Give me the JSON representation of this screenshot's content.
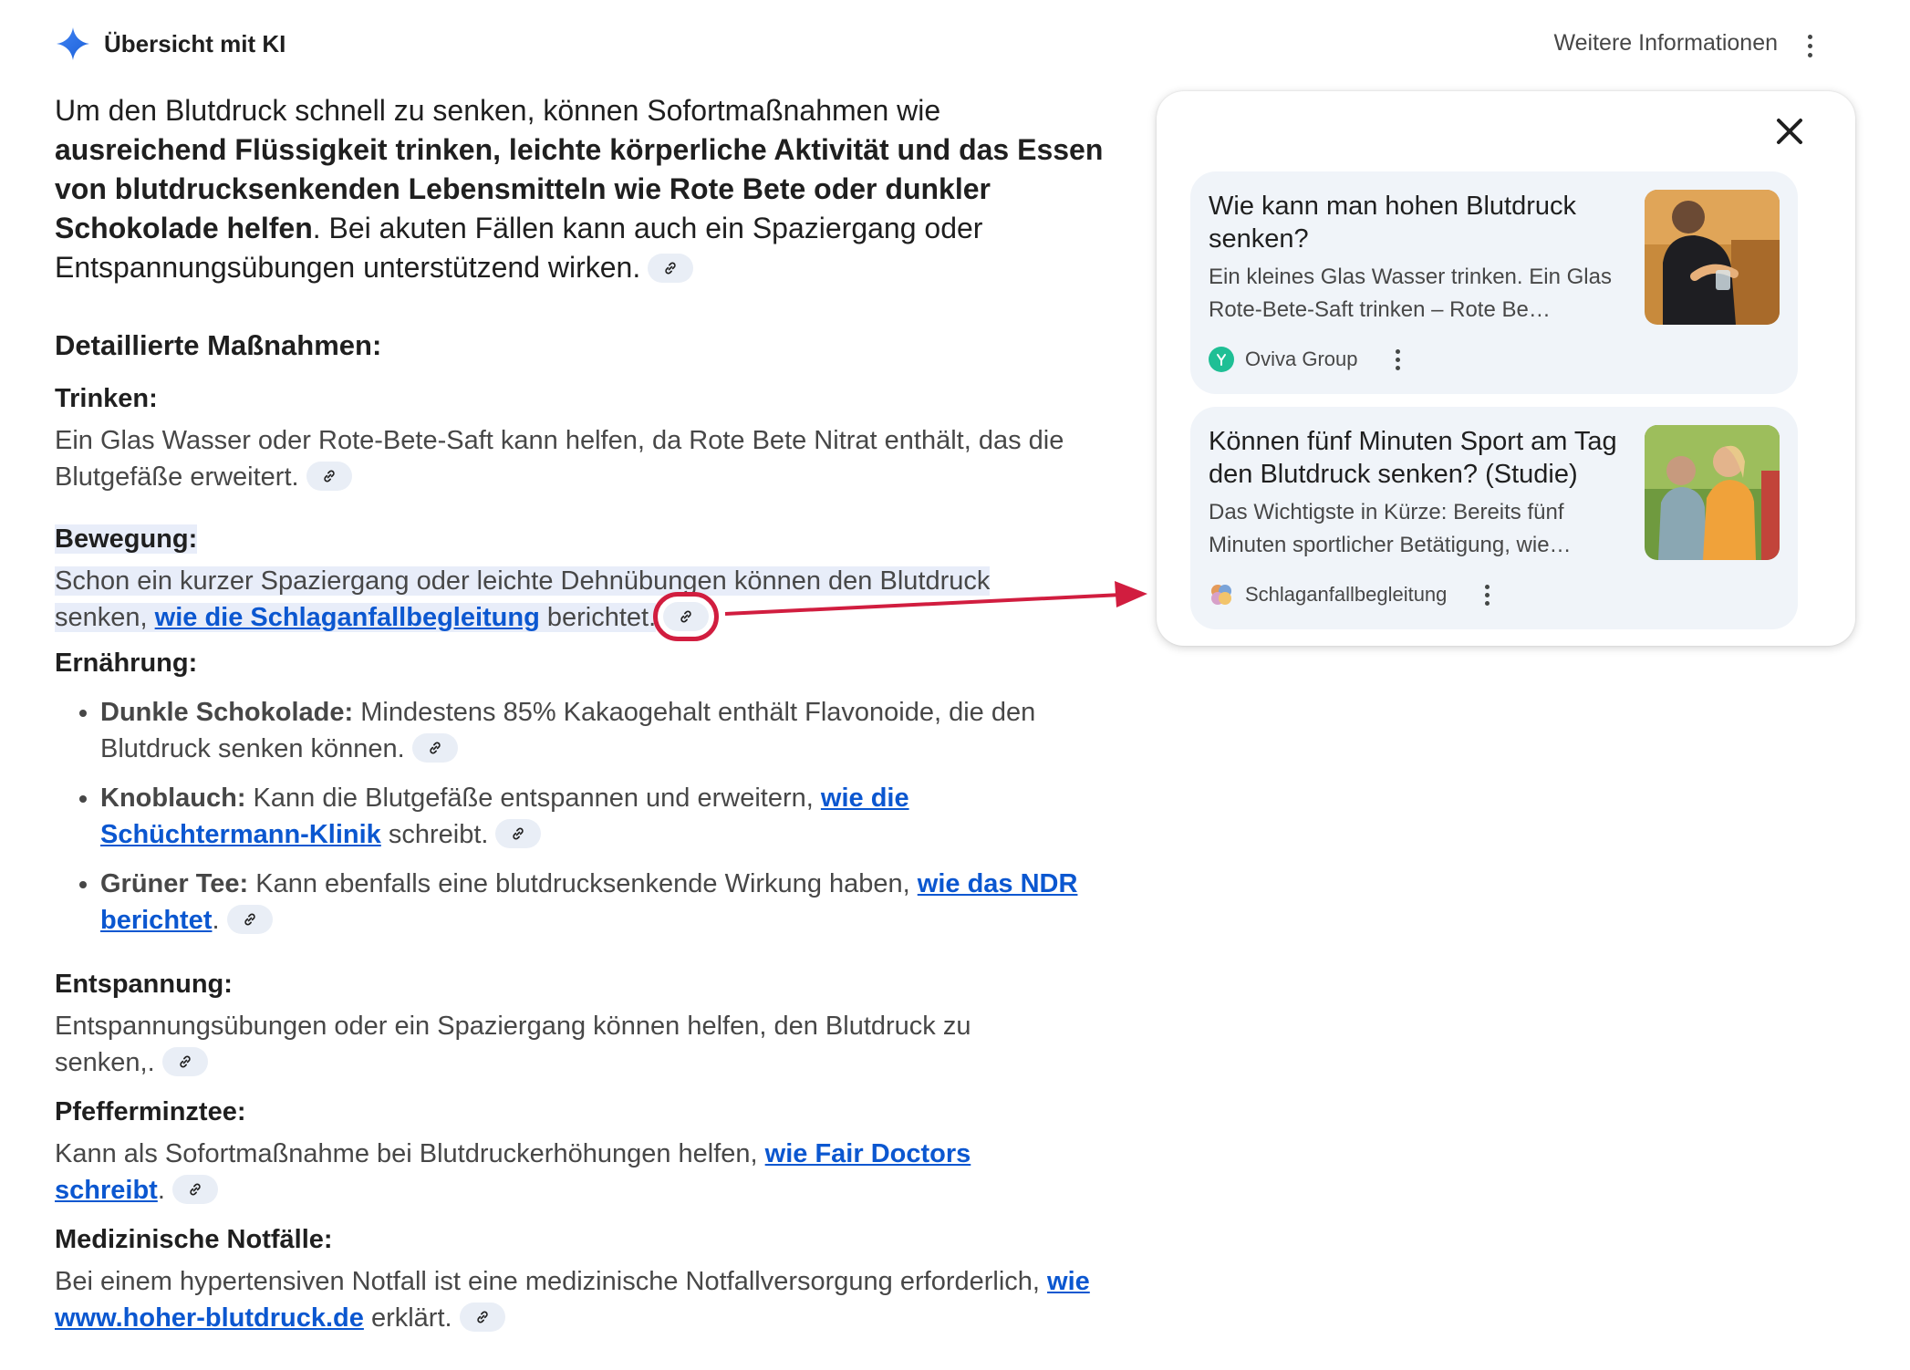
{
  "header": {
    "title": "Übersicht mit KI",
    "more_info": "Weitere Informationen"
  },
  "intro": {
    "part1": "Um den Blutdruck schnell zu senken, können Sofortmaßnahmen wie ",
    "bold": "ausreichend Flüssigkeit trinken, leichte körperliche Aktivität und das Essen von blutdrucksenkenden Lebensmitteln wie Rote Bete oder dunkler Schokolade helfen",
    "part2": ". Bei akuten Fällen kann auch ein Spaziergang oder Entspannungsübungen unterstützend wirken."
  },
  "detail_heading": "Detaillierte Maßnahmen:",
  "sections": {
    "trinken": {
      "title": "Trinken:",
      "text": "Ein Glas Wasser oder Rote-Bete-Saft kann helfen, da Rote Bete Nitrat enthält, das die Blutgefäße erweitert."
    },
    "bewegung": {
      "title": "Bewegung:",
      "text1": "Schon ein kurzer Spaziergang oder leichte Dehnübungen können den Blutdruck senken, ",
      "link": "wie die Schlaganfallbegleitung",
      "text2": " berichtet."
    },
    "ernaehrung": {
      "title": "Ernährung:",
      "items": [
        {
          "bold": "Dunkle Schokolade:",
          "text": " Mindestens 85% Kakaogehalt enthält Flavonoide, die den Blutdruck senken können."
        },
        {
          "bold": "Knoblauch:",
          "text": " Kann die Blutgefäße entspannen und erweitern, ",
          "link": "wie die Schüchtermann-Klinik",
          "after": " schreibt."
        },
        {
          "bold": "Grüner Tee:",
          "text": " Kann ebenfalls eine blutdrucksenkende Wirkung haben, ",
          "link": "wie das NDR berichtet",
          "after": "."
        }
      ]
    },
    "entspannung": {
      "title": "Entspannung:",
      "text": "Entspannungsübungen oder ein Spaziergang können helfen, den Blutdruck zu senken,."
    },
    "pfefferminztee": {
      "title": "Pfefferminztee:",
      "text": "Kann als Sofortmaßnahme bei Blutdruckerhöhungen helfen, ",
      "link": "wie Fair Doctors schreibt",
      "after": "."
    },
    "notfaelle": {
      "title": "Medizinische Notfälle:",
      "text": "Bei einem hypertensiven Notfall ist eine medizinische Notfallversorgung erforderlich, ",
      "link": "wie www.hoher-blutdruck.de",
      "after": " erklärt."
    }
  },
  "panel": {
    "cards": [
      {
        "title": "Wie kann man hohen Blutdruck senken?",
        "desc": "Ein kleines Glas Wasser trinken. Ein Glas Rote-Bete-Saft trinken – Rote Be…",
        "source": "Oviva Group"
      },
      {
        "title": "Können fünf Minuten Sport am Tag den Blutdruck senken? (Studie)",
        "desc": "Das Wichtigste in Kürze: Bereits fünf Minuten sportlicher Betätigung, wie…",
        "source": "Schlaganfallbegleitung"
      }
    ]
  },
  "colors": {
    "link": "#0b57d0",
    "highlight": "#e8edf9",
    "annotation": "#d11d3f",
    "chip": "#e9eef6"
  }
}
